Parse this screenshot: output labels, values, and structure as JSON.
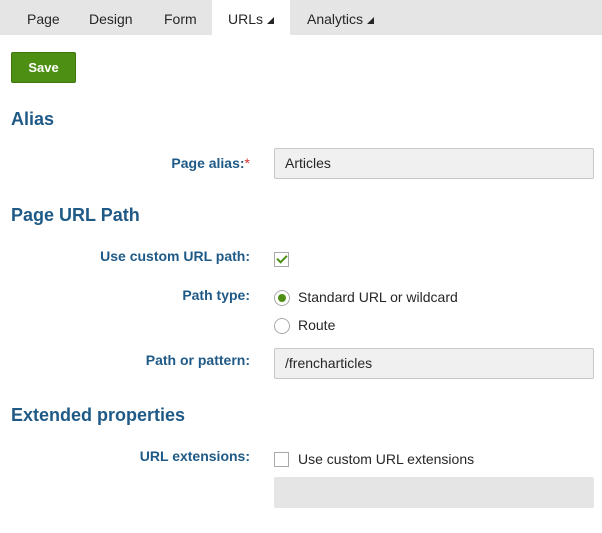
{
  "tabs": {
    "page": "Page",
    "design": "Design",
    "form": "Form",
    "urls": "URLs",
    "analytics": "Analytics"
  },
  "toolbar": {
    "save_label": "Save"
  },
  "alias_section": {
    "title": "Alias",
    "page_alias_label": "Page alias:",
    "required_mark": "*",
    "page_alias_value": "Articles"
  },
  "url_path_section": {
    "title": "Page URL Path",
    "custom_path_label": "Use custom URL path:",
    "custom_path_checked": true,
    "path_type_label": "Path type:",
    "path_type_options": [
      "Standard URL or wildcard",
      "Route"
    ],
    "path_type_selected": "Standard URL or wildcard",
    "pattern_label": "Path or pattern:",
    "pattern_value": "/frencharticles"
  },
  "extended_section": {
    "title": "Extended properties",
    "url_extensions_label": "URL extensions:",
    "custom_extensions_label": "Use custom URL extensions",
    "custom_extensions_checked": false,
    "extensions_value": ""
  },
  "colors": {
    "accent_green": "#4d8f13",
    "label_blue": "#1f5a87",
    "tab_bar_bg": "#e5e5e5",
    "required_red": "#d6312e"
  }
}
